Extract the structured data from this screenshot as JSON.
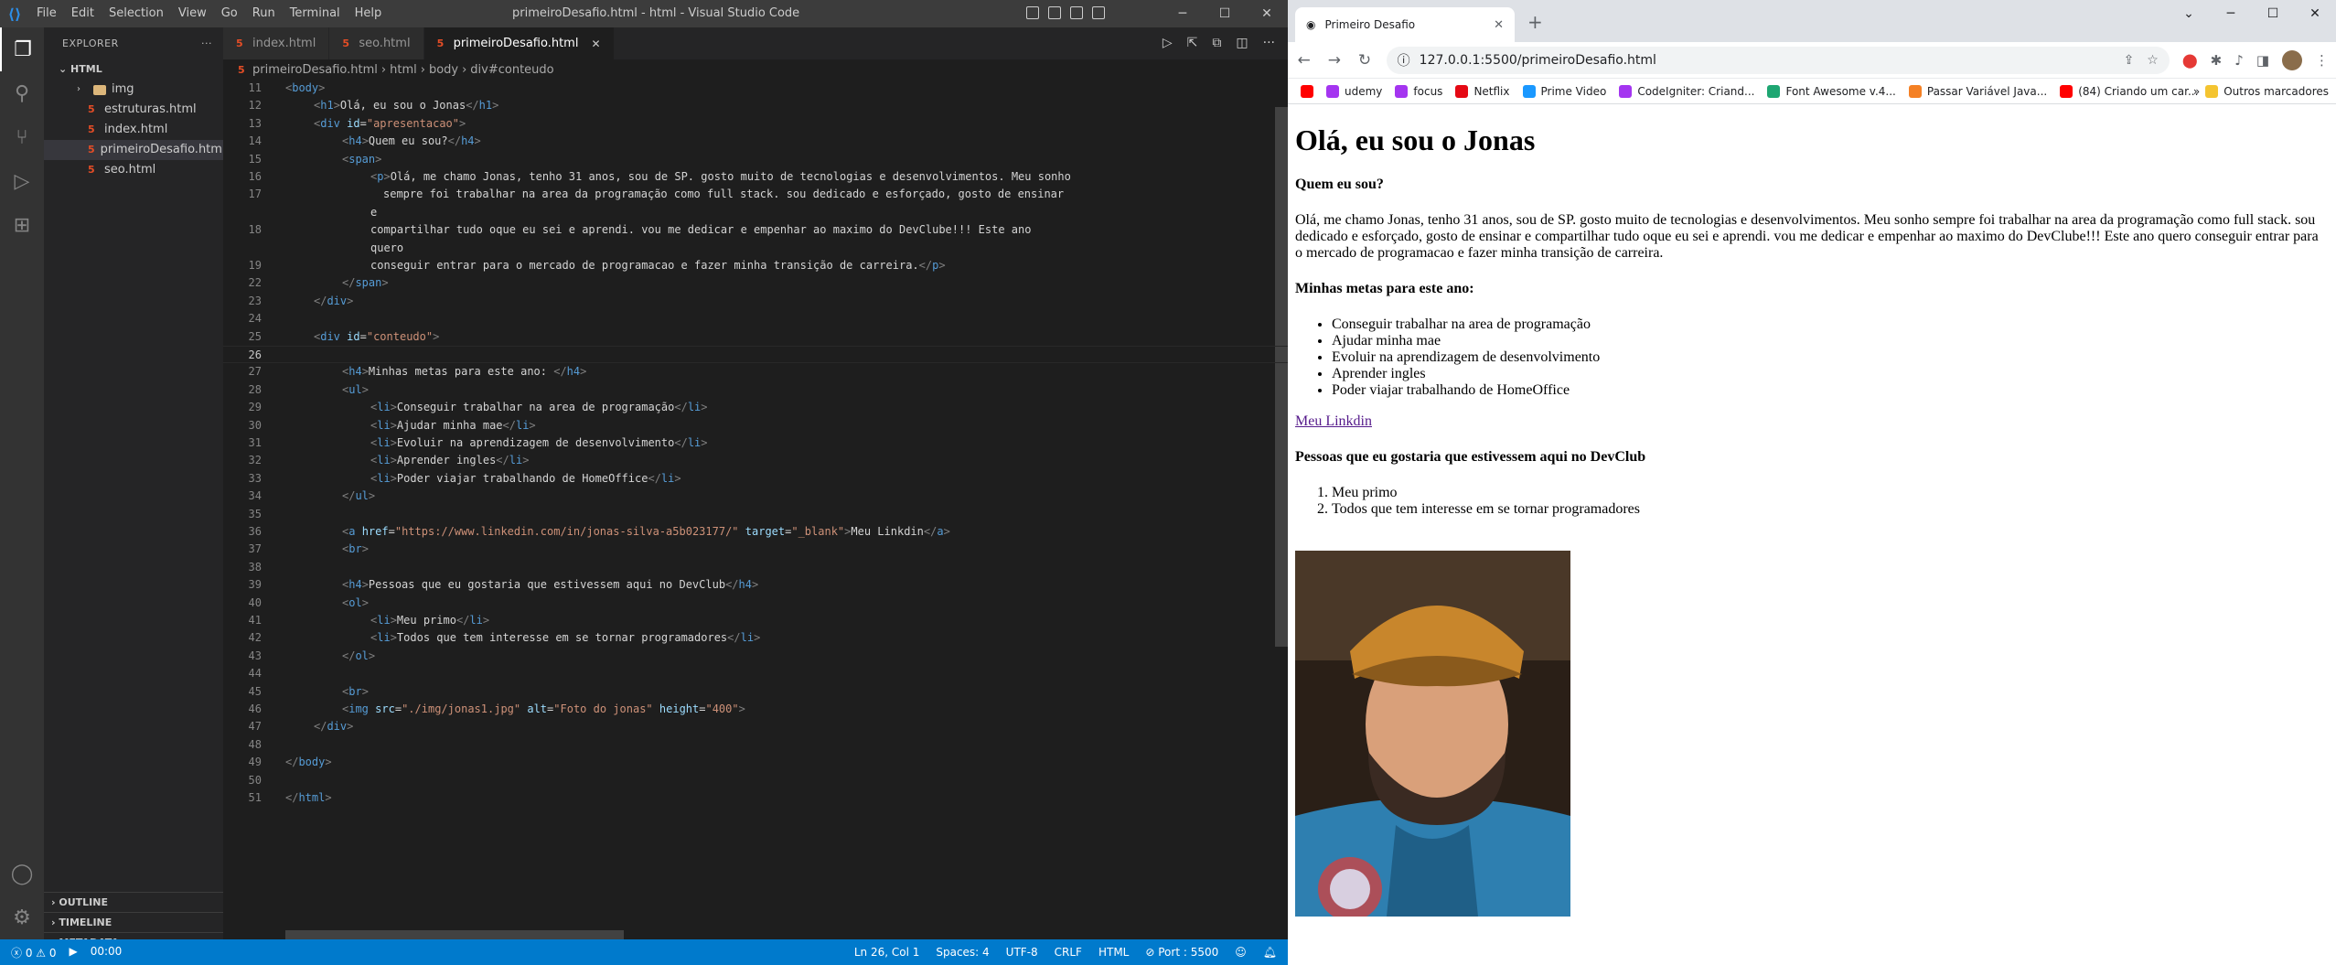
{
  "vscode": {
    "menu": [
      "File",
      "Edit",
      "Selection",
      "View",
      "Go",
      "Run",
      "Terminal",
      "Help"
    ],
    "window_title": "primeiroDesafio.html - html - Visual Studio Code",
    "explorer": {
      "header": "EXPLORER",
      "folder": "HTML",
      "items": [
        {
          "label": "img",
          "type": "folder"
        },
        {
          "label": "estruturas.html",
          "type": "file"
        },
        {
          "label": "index.html",
          "type": "file"
        },
        {
          "label": "primeiroDesafio.html",
          "type": "file",
          "active": true
        },
        {
          "label": "seo.html",
          "type": "file"
        }
      ],
      "sections": [
        "OUTLINE",
        "TIMELINE",
        "METADATA"
      ]
    },
    "tabs": [
      "index.html",
      "seo.html",
      "primeiroDesafio.html"
    ],
    "breadcrumb": [
      "primeiroDesafio.html",
      "html",
      "body",
      "div#conteudo"
    ],
    "status": {
      "errors": "0",
      "warnings": "0",
      "time": "00:00",
      "position": "Ln 26, Col 1",
      "spaces": "Spaces: 4",
      "encoding": "UTF-8",
      "eol": "CRLF",
      "language": "HTML",
      "port": "Port : 5500"
    },
    "code_lines": [
      {
        "n": "11",
        "i": 0,
        "tokens": [
          [
            "p",
            "<"
          ],
          [
            "t",
            "body"
          ],
          [
            "p",
            ">"
          ]
        ]
      },
      {
        "n": "12",
        "i": 1,
        "tokens": [
          [
            "p",
            "<"
          ],
          [
            "t",
            "h1"
          ],
          [
            "p",
            ">"
          ],
          [
            "x",
            "Olá, eu sou o Jonas"
          ],
          [
            "p",
            "</"
          ],
          [
            "t",
            "h1"
          ],
          [
            "p",
            ">"
          ]
        ]
      },
      {
        "n": "13",
        "i": 1,
        "tokens": [
          [
            "p",
            "<"
          ],
          [
            "t",
            "div"
          ],
          [
            "x",
            " "
          ],
          [
            "a",
            "id"
          ],
          [
            "x",
            "="
          ],
          [
            "s",
            "\"apresentacao\""
          ],
          [
            "p",
            ">"
          ]
        ]
      },
      {
        "n": "14",
        "i": 2,
        "tokens": [
          [
            "p",
            "<"
          ],
          [
            "t",
            "h4"
          ],
          [
            "p",
            ">"
          ],
          [
            "x",
            "Quem eu sou?"
          ],
          [
            "p",
            "</"
          ],
          [
            "t",
            "h4"
          ],
          [
            "p",
            ">"
          ]
        ]
      },
      {
        "n": "15",
        "i": 2,
        "tokens": [
          [
            "p",
            "<"
          ],
          [
            "t",
            "span"
          ],
          [
            "p",
            ">"
          ]
        ]
      },
      {
        "n": "16",
        "i": 3,
        "tokens": [
          [
            "p",
            "<"
          ],
          [
            "t",
            "p"
          ],
          [
            "p",
            ">"
          ],
          [
            "x",
            "Olá, me chamo Jonas, tenho 31 anos, sou de SP. gosto muito de tecnologias e desenvolvimentos. Meu sonho"
          ]
        ]
      },
      {
        "n": "17",
        "i": 3,
        "pad": 1,
        "tokens": [
          [
            "x",
            "sempre foi trabalhar na area da programação como full stack. sou dedicado e esforçado, gosto de ensinar"
          ]
        ]
      },
      {
        "n": "",
        "i": 3,
        "tokens": [
          [
            "x",
            "e"
          ]
        ]
      },
      {
        "n": "18",
        "i": 3,
        "tokens": [
          [
            "x",
            "compartilhar tudo oque eu sei e aprendi. vou me dedicar e empenhar ao maximo do DevClube!!! Este ano"
          ]
        ]
      },
      {
        "n": "",
        "i": 3,
        "tokens": [
          [
            "x",
            "quero"
          ]
        ]
      },
      {
        "n": "19",
        "i": 3,
        "tokens": [
          [
            "x",
            "conseguir entrar para o mercado de programacao e fazer minha transição de carreira."
          ],
          [
            "p",
            "</"
          ],
          [
            "t",
            "p"
          ],
          [
            "p",
            ">"
          ]
        ]
      },
      {
        "n": "22",
        "i": 2,
        "tokens": [
          [
            "p",
            "</"
          ],
          [
            "t",
            "span"
          ],
          [
            "p",
            ">"
          ]
        ]
      },
      {
        "n": "23",
        "i": 1,
        "tokens": [
          [
            "p",
            "</"
          ],
          [
            "t",
            "div"
          ],
          [
            "p",
            ">"
          ]
        ]
      },
      {
        "n": "24",
        "i": 0,
        "tokens": []
      },
      {
        "n": "25",
        "i": 1,
        "tokens": [
          [
            "p",
            "<"
          ],
          [
            "t",
            "div"
          ],
          [
            "x",
            " "
          ],
          [
            "a",
            "id"
          ],
          [
            "x",
            "="
          ],
          [
            "s",
            "\"conteudo\""
          ],
          [
            "p",
            ">"
          ]
        ]
      },
      {
        "n": "26",
        "i": 0,
        "cur": true,
        "tokens": []
      },
      {
        "n": "27",
        "i": 2,
        "tokens": [
          [
            "p",
            "<"
          ],
          [
            "t",
            "h4"
          ],
          [
            "p",
            ">"
          ],
          [
            "x",
            "Minhas metas para este ano: "
          ],
          [
            "p",
            "</"
          ],
          [
            "t",
            "h4"
          ],
          [
            "p",
            ">"
          ]
        ]
      },
      {
        "n": "28",
        "i": 2,
        "tokens": [
          [
            "p",
            "<"
          ],
          [
            "t",
            "ul"
          ],
          [
            "p",
            ">"
          ]
        ]
      },
      {
        "n": "29",
        "i": 3,
        "tokens": [
          [
            "p",
            "<"
          ],
          [
            "t",
            "li"
          ],
          [
            "p",
            ">"
          ],
          [
            "x",
            "Conseguir trabalhar na area de programação"
          ],
          [
            "p",
            "</"
          ],
          [
            "t",
            "li"
          ],
          [
            "p",
            ">"
          ]
        ]
      },
      {
        "n": "30",
        "i": 3,
        "tokens": [
          [
            "p",
            "<"
          ],
          [
            "t",
            "li"
          ],
          [
            "p",
            ">"
          ],
          [
            "x",
            "Ajudar minha mae"
          ],
          [
            "p",
            "</"
          ],
          [
            "t",
            "li"
          ],
          [
            "p",
            ">"
          ]
        ]
      },
      {
        "n": "31",
        "i": 3,
        "tokens": [
          [
            "p",
            "<"
          ],
          [
            "t",
            "li"
          ],
          [
            "p",
            ">"
          ],
          [
            "x",
            "Evoluir na aprendizagem de desenvolvimento"
          ],
          [
            "p",
            "</"
          ],
          [
            "t",
            "li"
          ],
          [
            "p",
            ">"
          ]
        ]
      },
      {
        "n": "32",
        "i": 3,
        "tokens": [
          [
            "p",
            "<"
          ],
          [
            "t",
            "li"
          ],
          [
            "p",
            ">"
          ],
          [
            "x",
            "Aprender ingles"
          ],
          [
            "p",
            "</"
          ],
          [
            "t",
            "li"
          ],
          [
            "p",
            ">"
          ]
        ]
      },
      {
        "n": "33",
        "i": 3,
        "tokens": [
          [
            "p",
            "<"
          ],
          [
            "t",
            "li"
          ],
          [
            "p",
            ">"
          ],
          [
            "x",
            "Poder viajar trabalhando de HomeOffice"
          ],
          [
            "p",
            "</"
          ],
          [
            "t",
            "li"
          ],
          [
            "p",
            ">"
          ]
        ]
      },
      {
        "n": "34",
        "i": 2,
        "tokens": [
          [
            "p",
            "</"
          ],
          [
            "t",
            "ul"
          ],
          [
            "p",
            ">"
          ]
        ]
      },
      {
        "n": "35",
        "i": 0,
        "tokens": []
      },
      {
        "n": "36",
        "i": 2,
        "tokens": [
          [
            "p",
            "<"
          ],
          [
            "t",
            "a"
          ],
          [
            "x",
            " "
          ],
          [
            "a",
            "href"
          ],
          [
            "x",
            "="
          ],
          [
            "s",
            "\"https://www.linkedin.com/in/jonas-silva-a5b023177/\""
          ],
          [
            "x",
            " "
          ],
          [
            "a",
            "target"
          ],
          [
            "x",
            "="
          ],
          [
            "s",
            "\"_blank\""
          ],
          [
            "p",
            ">"
          ],
          [
            "x",
            "Meu Linkdin"
          ],
          [
            "p",
            "</"
          ],
          [
            "t",
            "a"
          ],
          [
            "p",
            ">"
          ]
        ]
      },
      {
        "n": "37",
        "i": 2,
        "tokens": [
          [
            "p",
            "<"
          ],
          [
            "t",
            "br"
          ],
          [
            "p",
            ">"
          ]
        ]
      },
      {
        "n": "38",
        "i": 0,
        "tokens": []
      },
      {
        "n": "39",
        "i": 2,
        "tokens": [
          [
            "p",
            "<"
          ],
          [
            "t",
            "h4"
          ],
          [
            "p",
            ">"
          ],
          [
            "x",
            "Pessoas que eu gostaria que estivessem aqui no DevClub"
          ],
          [
            "p",
            "</"
          ],
          [
            "t",
            "h4"
          ],
          [
            "p",
            ">"
          ]
        ]
      },
      {
        "n": "40",
        "i": 2,
        "tokens": [
          [
            "p",
            "<"
          ],
          [
            "t",
            "ol"
          ],
          [
            "p",
            ">"
          ]
        ]
      },
      {
        "n": "41",
        "i": 3,
        "tokens": [
          [
            "p",
            "<"
          ],
          [
            "t",
            "li"
          ],
          [
            "p",
            ">"
          ],
          [
            "x",
            "Meu primo"
          ],
          [
            "p",
            "</"
          ],
          [
            "t",
            "li"
          ],
          [
            "p",
            ">"
          ]
        ]
      },
      {
        "n": "42",
        "i": 3,
        "tokens": [
          [
            "p",
            "<"
          ],
          [
            "t",
            "li"
          ],
          [
            "p",
            ">"
          ],
          [
            "x",
            "Todos que tem interesse em se tornar programadores"
          ],
          [
            "p",
            "</"
          ],
          [
            "t",
            "li"
          ],
          [
            "p",
            ">"
          ]
        ]
      },
      {
        "n": "43",
        "i": 2,
        "tokens": [
          [
            "p",
            "</"
          ],
          [
            "t",
            "ol"
          ],
          [
            "p",
            ">"
          ]
        ]
      },
      {
        "n": "44",
        "i": 0,
        "tokens": []
      },
      {
        "n": "45",
        "i": 2,
        "tokens": [
          [
            "p",
            "<"
          ],
          [
            "t",
            "br"
          ],
          [
            "p",
            ">"
          ]
        ]
      },
      {
        "n": "46",
        "i": 2,
        "tokens": [
          [
            "p",
            "<"
          ],
          [
            "t",
            "img"
          ],
          [
            "x",
            " "
          ],
          [
            "a",
            "src"
          ],
          [
            "x",
            "="
          ],
          [
            "s",
            "\"./img/jonas1.jpg\""
          ],
          [
            "x",
            " "
          ],
          [
            "a",
            "alt"
          ],
          [
            "x",
            "="
          ],
          [
            "s",
            "\"Foto do jonas\""
          ],
          [
            "x",
            " "
          ],
          [
            "a",
            "height"
          ],
          [
            "x",
            "="
          ],
          [
            "s",
            "\"400\""
          ],
          [
            "p",
            ">"
          ]
        ]
      },
      {
        "n": "47",
        "i": 1,
        "tokens": [
          [
            "p",
            "</"
          ],
          [
            "t",
            "div"
          ],
          [
            "p",
            ">"
          ]
        ]
      },
      {
        "n": "48",
        "i": 0,
        "tokens": []
      },
      {
        "n": "49",
        "i": 0,
        "tokens": [
          [
            "p",
            "</"
          ],
          [
            "t",
            "body"
          ],
          [
            "p",
            ">"
          ]
        ]
      },
      {
        "n": "50",
        "i": 0,
        "tokens": []
      },
      {
        "n": "51",
        "i": 0,
        "tokens": [
          [
            "p",
            "</"
          ],
          [
            "t",
            "html"
          ],
          [
            "p",
            ">"
          ]
        ]
      }
    ]
  },
  "chrome": {
    "tab_title": "Primeiro Desafio",
    "url": "127.0.0.1:5500/primeiroDesafio.html",
    "bookmarks": [
      {
        "label": "",
        "color": "#ff0000"
      },
      {
        "label": "udemy",
        "color": "#a435f0"
      },
      {
        "label": "focus",
        "color": "#a435f0"
      },
      {
        "label": "Netflix",
        "color": "#e50914"
      },
      {
        "label": "Prime Video",
        "color": "#1a98ff"
      },
      {
        "label": "CodeIgniter: Criand...",
        "color": "#a435f0"
      },
      {
        "label": "Font Awesome v.4...",
        "color": "#1ea672"
      },
      {
        "label": "Passar Variável Java...",
        "color": "#f48024"
      },
      {
        "label": "(84) Criando um car...",
        "color": "#ff0000"
      }
    ],
    "other_bookmarks": "Outros marcadores",
    "page": {
      "h1": "Olá, eu sou o Jonas",
      "who_title": "Quem eu sou?",
      "bio": "Olá, me chamo Jonas, tenho 31 anos, sou de SP. gosto muito de tecnologias e desenvolvimentos. Meu sonho sempre foi trabalhar na area da programação como full stack. sou dedicado e esforçado, gosto de ensinar e compartilhar tudo oque eu sei e aprendi. vou me dedicar e empenhar ao maximo do DevClube!!! Este ano quero conseguir entrar para o mercado de programacao e fazer minha transição de carreira.",
      "goals_title": "Minhas metas para este ano:",
      "goals": [
        "Conseguir trabalhar na area de programação",
        "Ajudar minha mae",
        "Evoluir na aprendizagem de desenvolvimento",
        "Aprender ingles",
        "Poder viajar trabalhando de HomeOffice"
      ],
      "link": "Meu Linkdin",
      "people_title": "Pessoas que eu gostaria que estivessem aqui no DevClub",
      "people": [
        "Meu primo",
        "Todos que tem interesse em se tornar programadores"
      ]
    }
  }
}
